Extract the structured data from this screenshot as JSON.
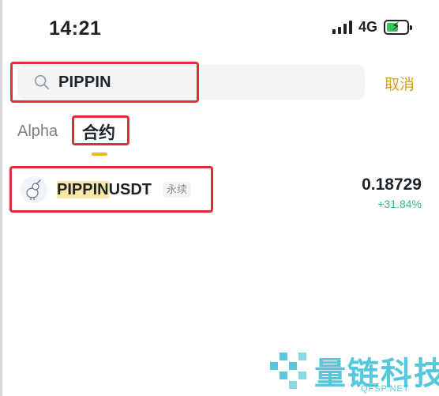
{
  "status_bar": {
    "time": "14:21",
    "network": "4G"
  },
  "search": {
    "value": "PIPPIN",
    "cancel_label": "取消"
  },
  "tabs": [
    {
      "label": "Alpha",
      "active": false
    },
    {
      "label": "合约",
      "active": true
    }
  ],
  "results": [
    {
      "symbol_match": "PIPPIN",
      "symbol_rest": "USDT",
      "badge": "永续",
      "price": "0.18729",
      "change": "+31.84%"
    }
  ],
  "watermark": {
    "brand": "量链科技",
    "url": "QFSP.NET"
  },
  "colors": {
    "accent": "#f0b90b",
    "cancel": "#d6a21b",
    "positive": "#2ebd85",
    "annotation": "#e02d3c",
    "watermark": "#38bfd6"
  }
}
